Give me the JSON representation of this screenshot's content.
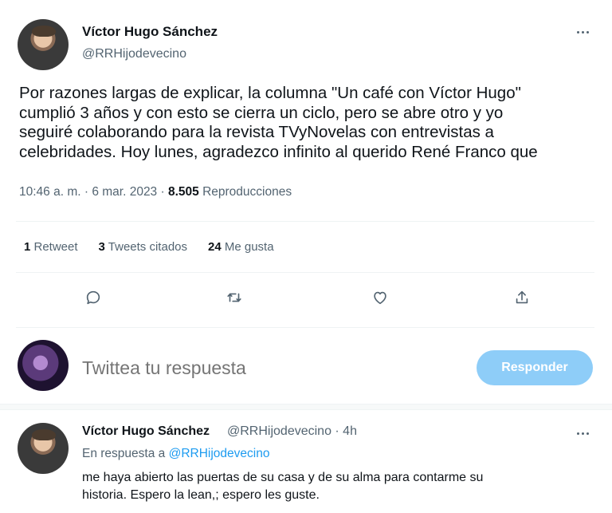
{
  "tweet": {
    "author_name": "Víctor Hugo Sánchez",
    "author_handle": "@RRHijodevecino",
    "body": "Por razones largas de explicar, la columna \"Un café con Víctor Hugo\"\ncumplió 3 años y con esto se cierra un ciclo, pero se abre otro y yo\nseguiré colaborando para la revista TVyNovelas con entrevistas a\ncelebridades. Hoy lunes, agradezco infinito al querido René Franco que",
    "timestamp": "10:46 a. m. · 6 mar. 2023 · ",
    "views_count": "8.505",
    "views_label": " Reproducciones"
  },
  "stats": {
    "retweets_count": "1",
    "retweets_label": " Retweet",
    "quotes_count": "3",
    "quotes_label": " Tweets citados",
    "likes_count": "24",
    "likes_label": " Me gusta"
  },
  "actions": {
    "icons": [
      "reply-icon",
      "retweet-icon",
      "like-icon",
      "share-icon"
    ]
  },
  "composer": {
    "placeholder": "Twittea tu respuesta",
    "button_label": "Responder",
    "button_color": "#8ecdf8"
  },
  "reply": {
    "author_name": "Víctor Hugo Sánchez",
    "author_handle_time": "@RRHijodevecino · 4h",
    "replying_prefix": "En respuesta a ",
    "replying_to": "@RRHijodevecino",
    "body": "me haya abierto las puertas de su casa y de su alma para contarme su\nhistoria. Espero la lean,; espero les guste."
  },
  "colors": {
    "text_primary": "#0f1419",
    "text_secondary": "#536471",
    "accent": "#1d9bf0"
  }
}
